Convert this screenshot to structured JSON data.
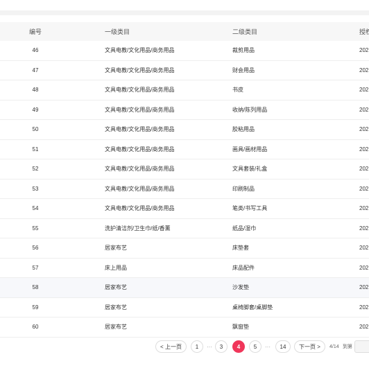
{
  "columns": {
    "no": "编号",
    "level1": "一级类目",
    "level2": "二级类目",
    "date": "授权"
  },
  "rows": [
    {
      "no": "46",
      "level1": "文具电教/文化用品/商务用品",
      "level2": "裁剪用品",
      "date": "202"
    },
    {
      "no": "47",
      "level1": "文具电教/文化用品/商务用品",
      "level2": "财会用品",
      "date": "202"
    },
    {
      "no": "48",
      "level1": "文具电教/文化用品/商务用品",
      "level2": "书皮",
      "date": "202"
    },
    {
      "no": "49",
      "level1": "文具电教/文化用品/商务用品",
      "level2": "收纳/陈列用品",
      "date": "202"
    },
    {
      "no": "50",
      "level1": "文具电教/文化用品/商务用品",
      "level2": "胶粘用品",
      "date": "202"
    },
    {
      "no": "51",
      "level1": "文具电教/文化用品/商务用品",
      "level2": "画具/画材用品",
      "date": "202"
    },
    {
      "no": "52",
      "level1": "文具电教/文化用品/商务用品",
      "level2": "文具套装/礼盒",
      "date": "202"
    },
    {
      "no": "53",
      "level1": "文具电教/文化用品/商务用品",
      "level2": "印刷制品",
      "date": "202"
    },
    {
      "no": "54",
      "level1": "文具电教/文化用品/商务用品",
      "level2": "笔类/书写工具",
      "date": "202"
    },
    {
      "no": "55",
      "level1": "洗护清洁剂/卫生巾/纸/香薰",
      "level2": "纸品/湿巾",
      "date": "202"
    },
    {
      "no": "56",
      "level1": "居家布艺",
      "level2": "床垫套",
      "date": "202"
    },
    {
      "no": "57",
      "level1": "床上用品",
      "level2": "床品配件",
      "date": "202"
    },
    {
      "no": "58",
      "level1": "居家布艺",
      "level2": "沙发垫",
      "date": "202"
    },
    {
      "no": "59",
      "level1": "居家布艺",
      "level2": "桌椅脚套/桌脚垫",
      "date": "202"
    },
    {
      "no": "60",
      "level1": "居家布艺",
      "level2": "飘窗垫",
      "date": "202"
    }
  ],
  "pagination": {
    "prev_label": "< 上一页",
    "next_label": "下一页 >",
    "pages": [
      "1",
      "3",
      "4",
      "5",
      "14"
    ],
    "current": "4",
    "ellipsis": "···",
    "info": "4/14",
    "jump_label": "到第"
  }
}
